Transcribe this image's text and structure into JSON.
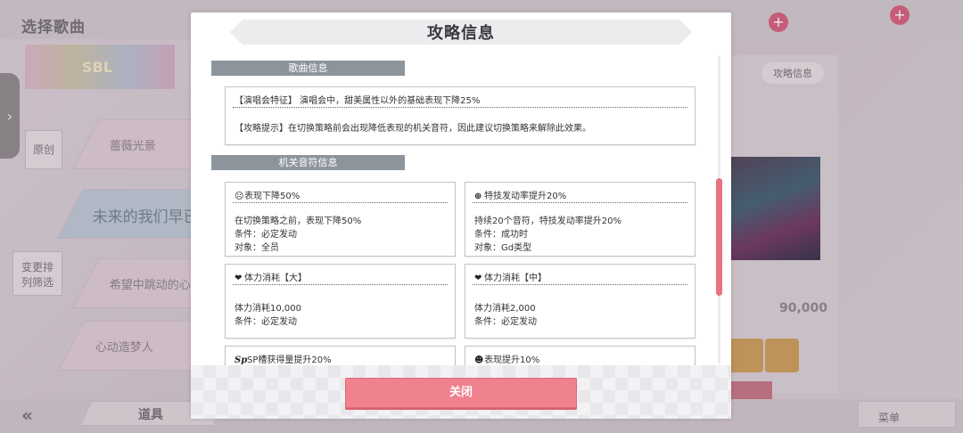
{
  "background": {
    "header_title": "选择歌曲",
    "banner_text": "SBL",
    "left_buttons": [
      {
        "label": "原创"
      },
      {
        "label": "变更排列筛选"
      }
    ],
    "song_items": [
      {
        "label": "蔷薇光景"
      },
      {
        "label": "未来的我们早已知晓"
      },
      {
        "label": "希望中跳动的心脏"
      },
      {
        "label": "心动造梦人"
      }
    ],
    "strategy_info_button": "攻略信息",
    "score": "90,000",
    "toolbar": {
      "items_label": "道具",
      "menu_label": "菜单"
    }
  },
  "dialog": {
    "title": "攻略信息",
    "sections": {
      "song_info_header": "歌曲信息",
      "notes_info_header": "机关音符信息"
    },
    "song_info": {
      "concert_feature": "【演唱会特征】 演唱会中，甜美属性以外的基础表现下降25%",
      "strategy_hint": "【攻略提示】在切换策略前会出现降低表现的机关音符，因此建议切换策略来解除此效果。"
    },
    "note_cards": [
      {
        "icon": "☹",
        "icon_name": "performance-down-icon",
        "title": "表现下降50%",
        "lines": [
          "在切换策略之前，表现下降50%",
          "条件：必定发动",
          "对象：全员"
        ]
      },
      {
        "icon": "⊕",
        "icon_name": "skill-rate-up-icon",
        "title": "特技发动率提升20%",
        "lines": [
          "持续20个音符，特技发动率提升20%",
          "条件：成功时",
          "对象：Gd类型"
        ]
      },
      {
        "icon": "❤",
        "icon_name": "stamina-drain-icon",
        "title": "体力消耗【大】",
        "lines": [
          "体力消耗10,000",
          "条件：必定发动"
        ]
      },
      {
        "icon": "❤",
        "icon_name": "stamina-drain-icon",
        "title": "体力消耗【中】",
        "lines": [
          "体力消耗2,000",
          "条件：必定发动"
        ]
      },
      {
        "icon": "Sp",
        "icon_name": "sp-gauge-icon",
        "title": "SP槽获得量提升20%",
        "lines": []
      },
      {
        "icon": "☻",
        "icon_name": "performance-up-icon",
        "title": "表现提升10%",
        "lines": []
      }
    ],
    "close_button": "关闭"
  },
  "colors": {
    "accent": "#f0818f",
    "section_header": "#8d949c",
    "scrollbar_thumb": "#e8727f"
  }
}
